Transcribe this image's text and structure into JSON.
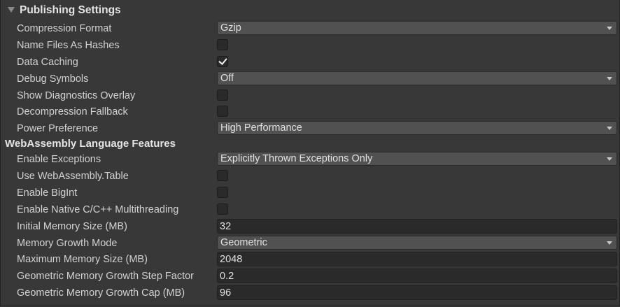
{
  "section": {
    "title": "Publishing Settings",
    "icon": "triangle-down-icon"
  },
  "rows": {
    "compression_format": {
      "label": "Compression Format",
      "value": "Gzip"
    },
    "name_files_as_hashes": {
      "label": "Name Files As Hashes",
      "checked": false
    },
    "data_caching": {
      "label": "Data Caching",
      "checked": true
    },
    "debug_symbols": {
      "label": "Debug Symbols",
      "value": "Off"
    },
    "show_diagnostics_overlay": {
      "label": "Show Diagnostics Overlay",
      "checked": false
    },
    "decompression_fallback": {
      "label": "Decompression Fallback",
      "checked": false
    },
    "power_preference": {
      "label": "Power Preference",
      "value": "High Performance"
    }
  },
  "wasm": {
    "title": "WebAssembly Language Features",
    "enable_exceptions": {
      "label": "Enable Exceptions",
      "value": "Explicitly Thrown Exceptions Only"
    },
    "use_wasm_table": {
      "label": "Use WebAssembly.Table",
      "checked": false
    },
    "enable_bigint": {
      "label": "Enable BigInt",
      "checked": false
    },
    "enable_multithreading": {
      "label": "Enable Native C/C++ Multithreading",
      "checked": false
    },
    "initial_memory_size": {
      "label": "Initial Memory Size (MB)",
      "value": "32"
    },
    "memory_growth_mode": {
      "label": "Memory Growth Mode",
      "value": "Geometric"
    },
    "maximum_memory_size": {
      "label": "Maximum Memory Size (MB)",
      "value": "2048"
    },
    "geometric_step_factor": {
      "label": "Geometric Memory Growth Step Factor",
      "value": "0.2"
    },
    "geometric_growth_cap": {
      "label": "Geometric Memory Growth Cap (MB)",
      "value": "96"
    }
  }
}
